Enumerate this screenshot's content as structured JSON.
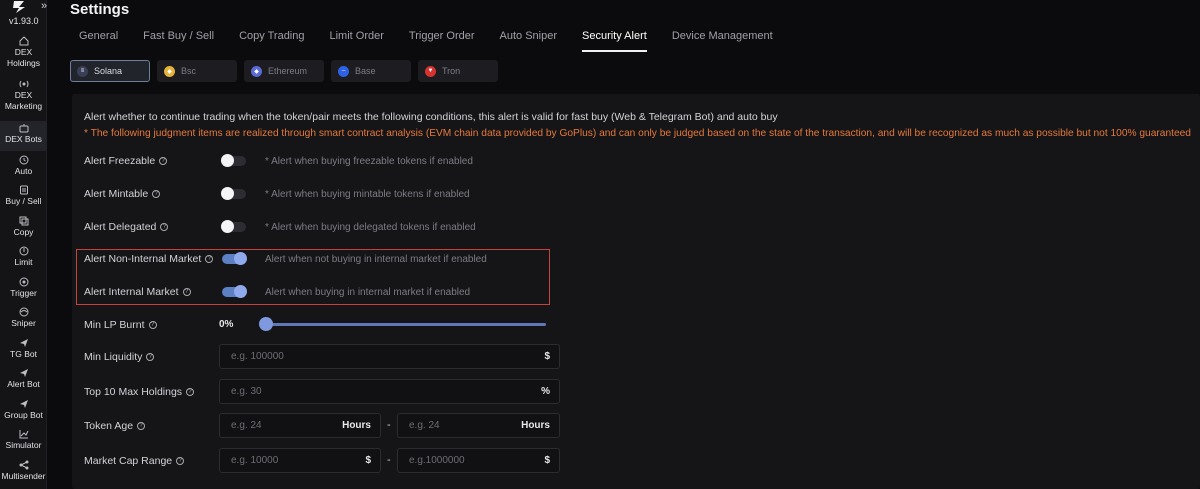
{
  "app": {
    "version": "v1.93.0"
  },
  "sidebar": {
    "items": [
      {
        "label_line1": "DEX",
        "label_line2": "Holdings",
        "icon": "home-icon"
      },
      {
        "label_line1": "DEX",
        "label_line2": "Marketing",
        "icon": "signal-icon"
      },
      {
        "label_line1": "DEX Bots",
        "label_line2": "",
        "icon": "bot-icon"
      },
      {
        "label_line1": "Auto",
        "label_line2": "",
        "icon": "clock-icon"
      },
      {
        "label_line1": "Buy / Sell",
        "label_line2": "",
        "icon": "document-icon"
      },
      {
        "label_line1": "Copy",
        "label_line2": "",
        "icon": "copy-icon"
      },
      {
        "label_line1": "Limit",
        "label_line2": "",
        "icon": "limit-icon"
      },
      {
        "label_line1": "Trigger",
        "label_line2": "",
        "icon": "trigger-icon"
      },
      {
        "label_line1": "Sniper",
        "label_line2": "",
        "icon": "sniper-icon"
      },
      {
        "label_line1": "TG Bot",
        "label_line2": "",
        "icon": "send-icon"
      },
      {
        "label_line1": "Alert Bot",
        "label_line2": "",
        "icon": "send-icon"
      },
      {
        "label_line1": "Group Bot",
        "label_line2": "",
        "icon": "send-icon"
      },
      {
        "label_line1": "Simulator",
        "label_line2": "",
        "icon": "chart-icon"
      },
      {
        "label_line1": "Multisender",
        "label_line2": "",
        "icon": "share-icon"
      }
    ]
  },
  "header": {
    "title": "Settings"
  },
  "tabs": [
    "General",
    "Fast Buy / Sell",
    "Copy Trading",
    "Limit Order",
    "Trigger Order",
    "Auto Sniper",
    "Security Alert",
    "Device Management"
  ],
  "active_tab": "Security Alert",
  "chains": [
    {
      "label": "Solana",
      "color": "#3a3f58",
      "active": true
    },
    {
      "label": "Bsc",
      "color": "#e6b33a",
      "active": false
    },
    {
      "label": "Ethereum",
      "color": "#5a6bd6",
      "active": false
    },
    {
      "label": "Base",
      "color": "#2d62e6",
      "active": false
    },
    {
      "label": "Tron",
      "color": "#d6322f",
      "active": false
    }
  ],
  "panel": {
    "description": "Alert whether to continue trading when the token/pair meets the following conditions, this alert is valid for fast buy (Web & Telegram Bot) and auto buy",
    "warning": "* The following judgment items are realized through smart contract analysis (EVM chain data provided by GoPlus) and can only be judged based on the state of the transaction, and will be recognized as much as possible but not 100% guaranteed",
    "alerts": [
      {
        "label": "Alert Freezable",
        "hint": "* Alert when buying freezable tokens if enabled",
        "enabled": false
      },
      {
        "label": "Alert Mintable",
        "hint": "* Alert when buying mintable tokens if enabled",
        "enabled": false
      },
      {
        "label": "Alert Delegated",
        "hint": "* Alert when buying delegated tokens if enabled",
        "enabled": false
      },
      {
        "label": "Alert Non-Internal Market",
        "hint": "Alert when not buying in internal market if enabled",
        "enabled": true
      },
      {
        "label": "Alert Internal Market",
        "hint": "Alert when buying in internal market if enabled",
        "enabled": true
      }
    ],
    "min_lp_burnt": {
      "label": "Min LP Burnt",
      "value": "0%",
      "percent": 0
    },
    "min_liquidity": {
      "label": "Min Liquidity",
      "placeholder": "e.g. 100000",
      "unit": "$"
    },
    "top10": {
      "label": "Top 10 Max Holdings",
      "placeholder": "e.g. 30",
      "unit": "%"
    },
    "token_age": {
      "label": "Token Age",
      "min_placeholder": "e.g. 24",
      "max_placeholder": "e.g. 24",
      "unit": "Hours",
      "separator": "-"
    },
    "market_cap": {
      "label": "Market Cap Range",
      "min_placeholder": "e.g. 10000",
      "max_placeholder": "e.g.1000000",
      "unit": "$",
      "separator": "-"
    }
  }
}
